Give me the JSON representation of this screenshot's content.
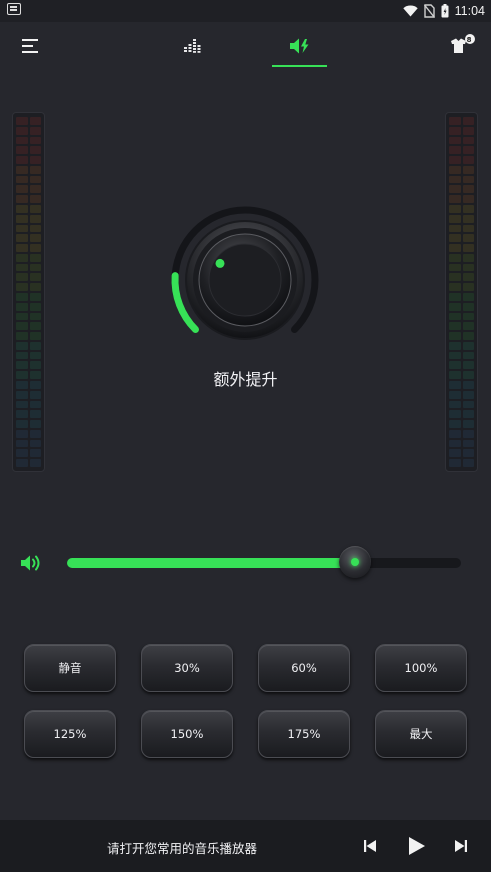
{
  "status_bar": {
    "time": "11:04",
    "icons": [
      "app-notification-icon",
      "wifi-icon",
      "no-sim-icon",
      "battery-icon"
    ]
  },
  "top_nav": {
    "menu_icon": "menu-icon",
    "tabs": [
      {
        "icon": "equalizer-icon",
        "active": false
      },
      {
        "icon": "volume-boost-icon",
        "active": true
      }
    ],
    "theme_icon": "theme-skin-icon",
    "theme_badge": "8"
  },
  "boost": {
    "label": "额外提升",
    "level": 0.18
  },
  "volume": {
    "icon": "speaker-icon",
    "level": 0.73
  },
  "presets": [
    {
      "label": "静音"
    },
    {
      "label": "30%"
    },
    {
      "label": "60%"
    },
    {
      "label": "100%"
    },
    {
      "label": "125%"
    },
    {
      "label": "150%"
    },
    {
      "label": "175%"
    },
    {
      "label": "最大"
    }
  ],
  "player": {
    "prompt": "请打开您常用的音乐播放器",
    "prev_icon": "skip-previous-icon",
    "play_icon": "play-icon",
    "next_icon": "skip-next-icon"
  },
  "colors": {
    "accent": "#37e157",
    "background": "#26272d",
    "bar": "#1b1c20"
  }
}
